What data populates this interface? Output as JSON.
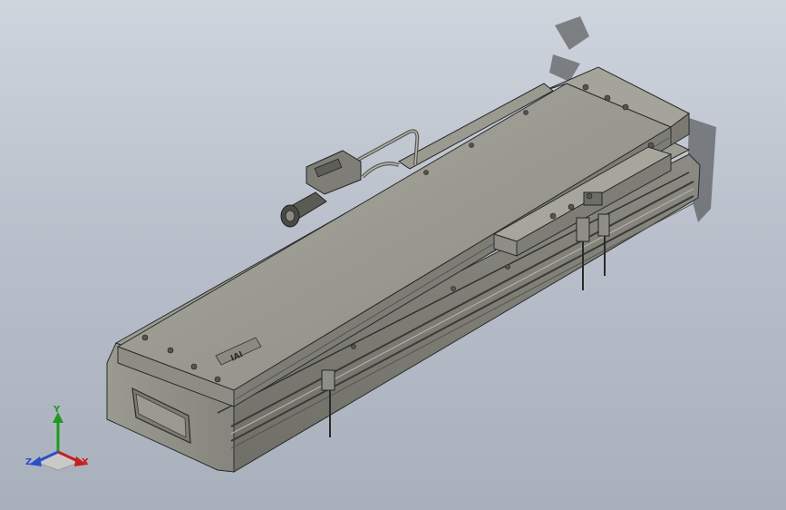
{
  "viewport": {
    "background_top": "#cfd5dd",
    "background_bottom": "#a8b0bc",
    "part_color": "#8f8f86",
    "part_dark": "#6d6d66",
    "edge_color": "#2a2a2a"
  },
  "triad": {
    "x_label": "X",
    "y_label": "Y",
    "z_label": "Z",
    "x_color": "#c81e1e",
    "y_color": "#1f9a1f",
    "z_color": "#2b4fc9"
  },
  "model": {
    "logo_text": "IAI"
  }
}
